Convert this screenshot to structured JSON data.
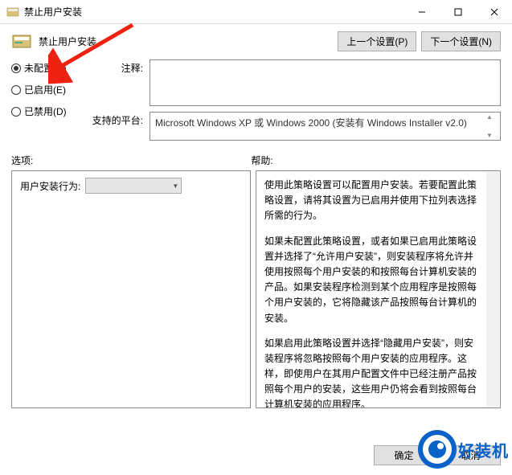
{
  "title": "禁止用户安装",
  "header_title": "禁止用户安装",
  "nav": {
    "prev": "上一个设置(P)",
    "next": "下一个设置(N)"
  },
  "radios": {
    "not_configured": "未配置(C)",
    "enabled": "已启用(E)",
    "disabled": "已禁用(D)"
  },
  "labels": {
    "comment": "注释:",
    "platform": "支持的平台:",
    "options": "选项:",
    "help": "帮助:",
    "user_behavior": "用户安装行为:"
  },
  "platform_text": "Microsoft Windows XP 或 Windows 2000 (安装有 Windows Installer v2.0)",
  "help": {
    "p1": "使用此策略设置可以配置用户安装。若要配置此策略设置，请将其设置为已启用并使用下拉列表选择所需的行为。",
    "p2": "如果未配置此策略设置，或者如果已启用此策略设置并选择了“允许用户安装”，则安装程序将允许并使用按照每个用户安装的和按照每台计算机安装的产品。如果安装程序检测到某个应用程序是按照每个用户安装的，它将隐藏该产品按照每台计算机的安装。",
    "p3": "如果启用此策略设置并选择“隐藏用户安装”，则安装程序将忽略按照每个用户安装的应用程序。这样，即使用户在其用户配置文件中已经注册产品按照每个用户的安装，这些用户仍将会看到按照每台计算机安装的应用程序。"
  },
  "footer": {
    "ok": "确定",
    "cancel": "取消"
  },
  "watermark": "好装机"
}
